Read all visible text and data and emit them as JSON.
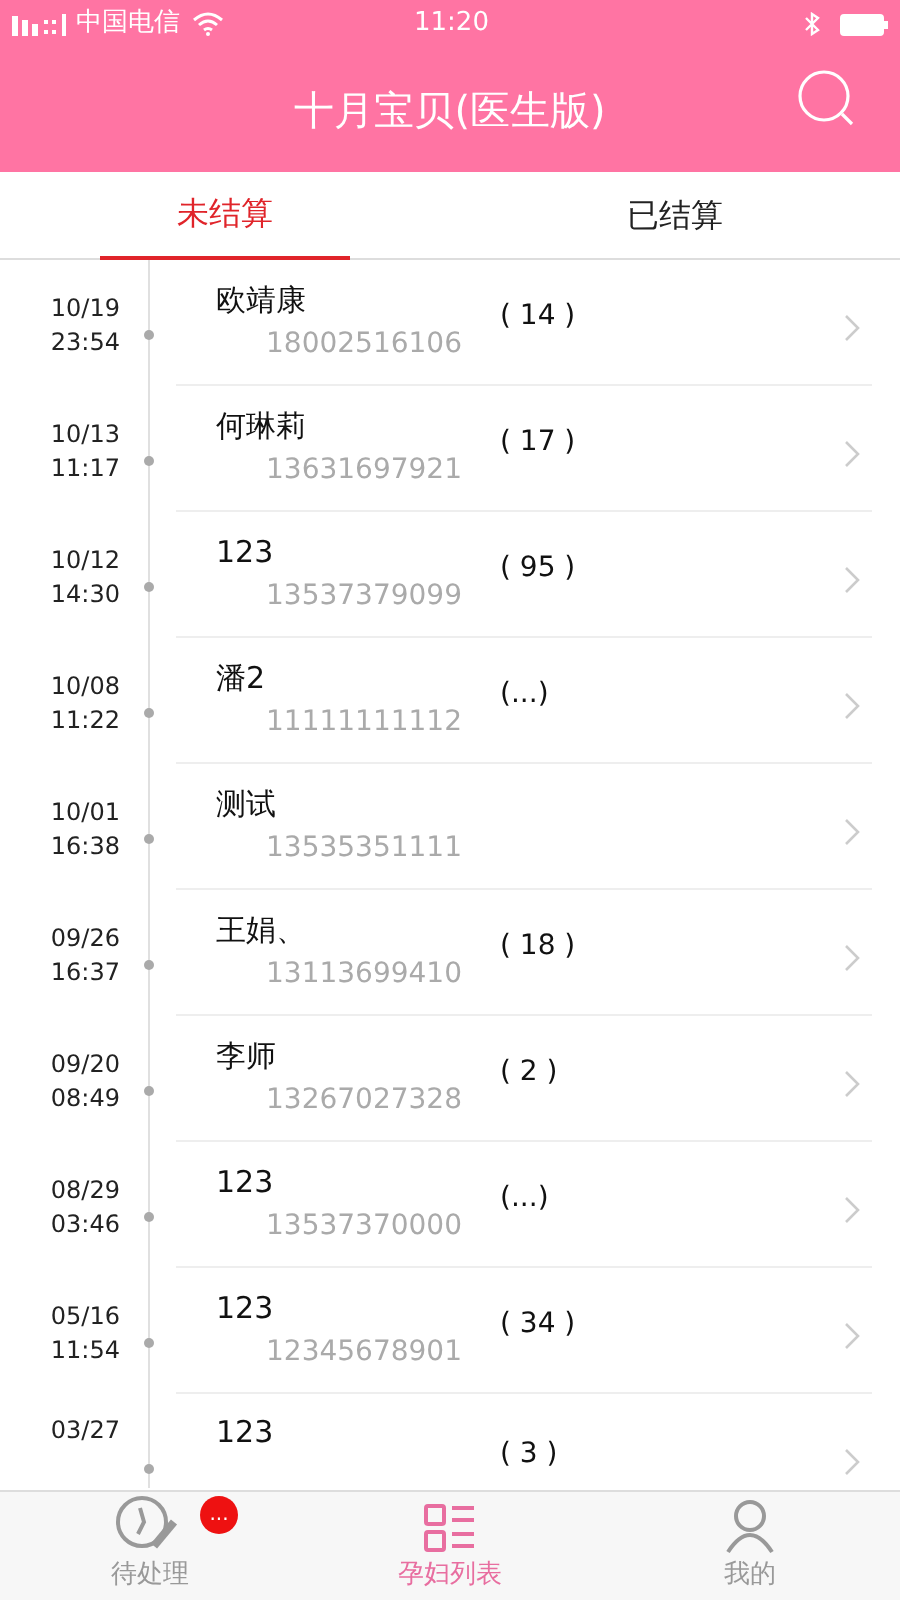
{
  "status_bar": {
    "carrier": "中国电信",
    "time": "11:20"
  },
  "header": {
    "title": "十月宝贝(医生版)"
  },
  "tabs": [
    {
      "label": "未结算",
      "selected": true
    },
    {
      "label": "已结算",
      "selected": false
    }
  ],
  "rows": [
    {
      "date": "10/19",
      "time": "23:54",
      "name": "欧靖康",
      "phone": "18002516106",
      "count": "( 14 )"
    },
    {
      "date": "10/13",
      "time": "11:17",
      "name": "何琳莉",
      "phone": "13631697921",
      "count": "( 17 )"
    },
    {
      "date": "10/12",
      "time": "14:30",
      "name": "123",
      "phone": "13537379099",
      "count": "( 95 )"
    },
    {
      "date": "10/08",
      "time": "11:22",
      "name": "潘2",
      "phone": "11111111112",
      "count": "(...)"
    },
    {
      "date": "10/01",
      "time": "16:38",
      "name": "测试",
      "phone": "13535351111",
      "count": ""
    },
    {
      "date": "09/26",
      "time": "16:37",
      "name": "王娟、",
      "phone": "13113699410",
      "count": "( 18 )"
    },
    {
      "date": "09/20",
      "time": "08:49",
      "name": "李师",
      "phone": "13267027328",
      "count": "( 2 )"
    },
    {
      "date": "08/29",
      "time": "03:46",
      "name": "123",
      "phone": "13537370000",
      "count": "(...)"
    },
    {
      "date": "05/16",
      "time": "11:54",
      "name": "123",
      "phone": "12345678901",
      "count": "( 34 )"
    },
    {
      "date": "03/27",
      "name": "123",
      "count": "( 3 )"
    }
  ],
  "bottom_nav": [
    {
      "label": "待处理",
      "selected": false,
      "badge": "..."
    },
    {
      "label": "孕妇列表",
      "selected": true
    },
    {
      "label": "我的",
      "selected": false
    }
  ]
}
